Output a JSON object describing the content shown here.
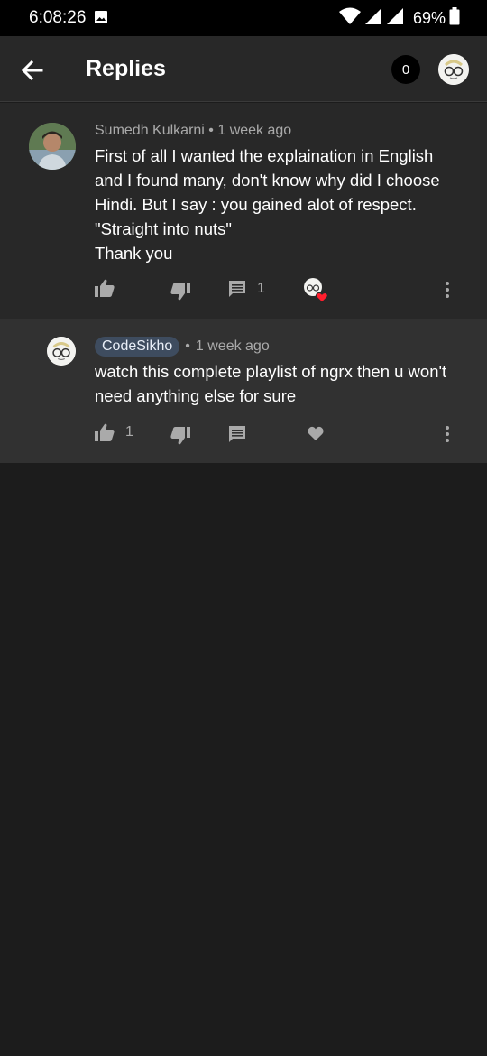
{
  "status_bar": {
    "time": "6:08:26",
    "battery": "69%"
  },
  "app_bar": {
    "title": "Replies",
    "notification_count": "0"
  },
  "comment": {
    "author": "Sumedh Kulkarni",
    "separator": "•",
    "age": "1 week ago",
    "text": "First of all I wanted the explaination in English and I found many, don't know why did I choose Hindi. But I say : you gained alot of respect.\n\"Straight into nuts\"\nThank you",
    "reply_count": "1"
  },
  "reply": {
    "author": "CodeSikho",
    "separator": "•",
    "age": "1 week ago",
    "text": "watch this complete playlist of ngrx then u won't need anything else for sure",
    "like_count": "1"
  },
  "colors": {
    "background": "#1c1c1c",
    "app_bar": "#282828",
    "reply_background": "#313131",
    "heart_red": "#ff1e2d"
  }
}
